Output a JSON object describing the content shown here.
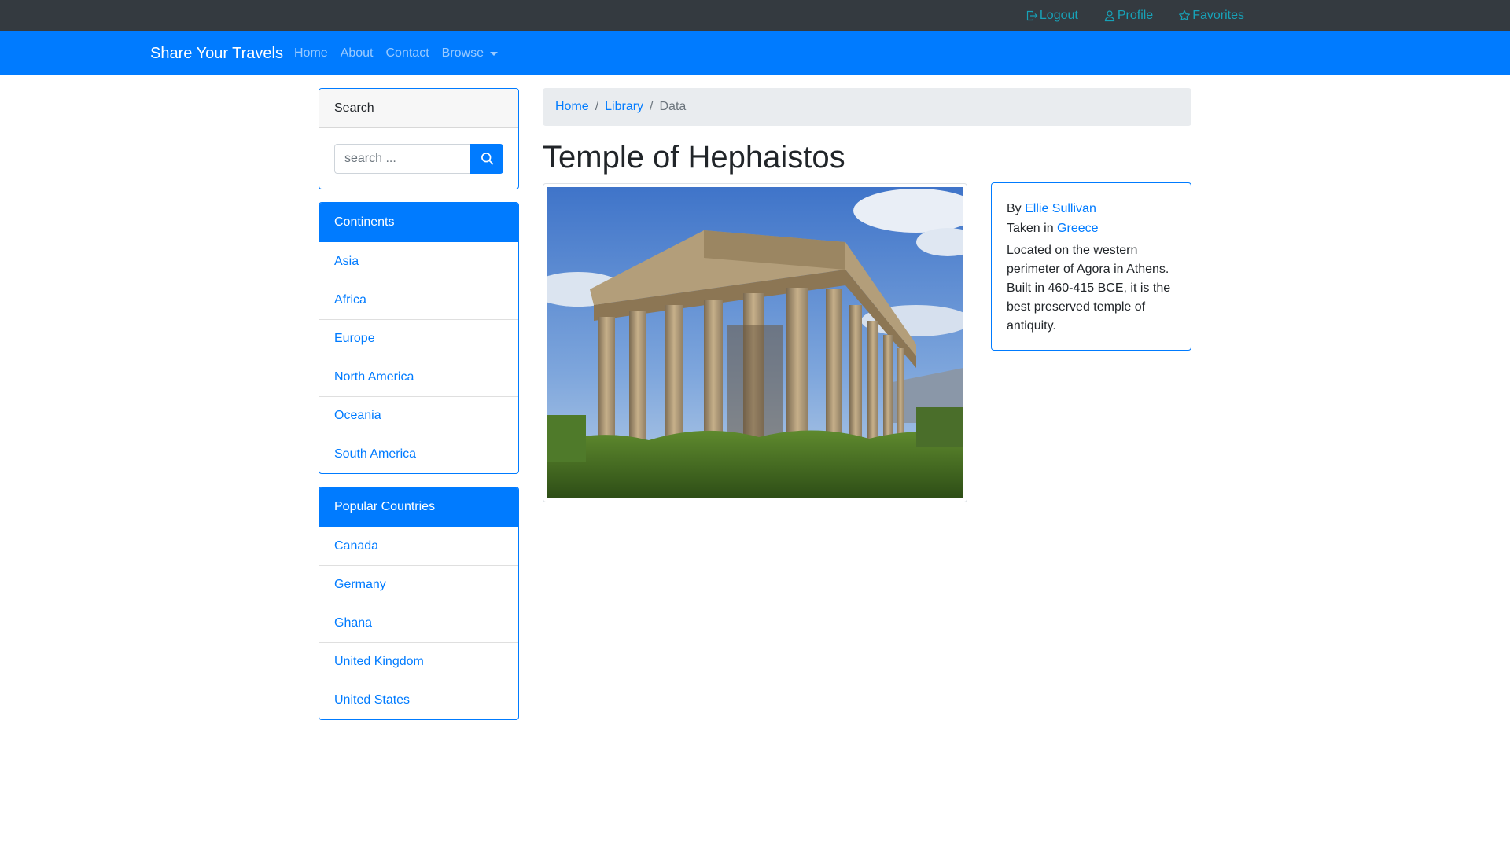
{
  "topbar": {
    "logout": "Logout",
    "profile": "Profile",
    "favorites": "Favorites"
  },
  "navbar": {
    "brand": "Share Your Travels",
    "links": [
      "Home",
      "About",
      "Contact"
    ],
    "browse": "Browse"
  },
  "sidebar": {
    "search": {
      "title": "Search",
      "placeholder": "search ..."
    },
    "continents": {
      "title": "Continents",
      "items": [
        "Asia",
        "Africa",
        "Europe",
        "North America",
        "Oceania",
        "South America"
      ]
    },
    "countries": {
      "title": "Popular Countries",
      "items": [
        "Canada",
        "Germany",
        "Ghana",
        "United Kingdom",
        "United States"
      ]
    }
  },
  "breadcrumb": [
    "Home",
    "Library",
    "Data"
  ],
  "photo": {
    "title": "Temple of Hephaistos",
    "by_label": "By",
    "author": "Ellie Sullivan",
    "taken_label": "Taken in",
    "country": "Greece",
    "description": "Located on the western perimeter of Agora in Athens. Built in 460-415 BCE, it is the best preserved temple of antiquity."
  },
  "colors": {
    "primary": "#007bff",
    "dark": "#343a40",
    "info": "#17a2b8"
  }
}
